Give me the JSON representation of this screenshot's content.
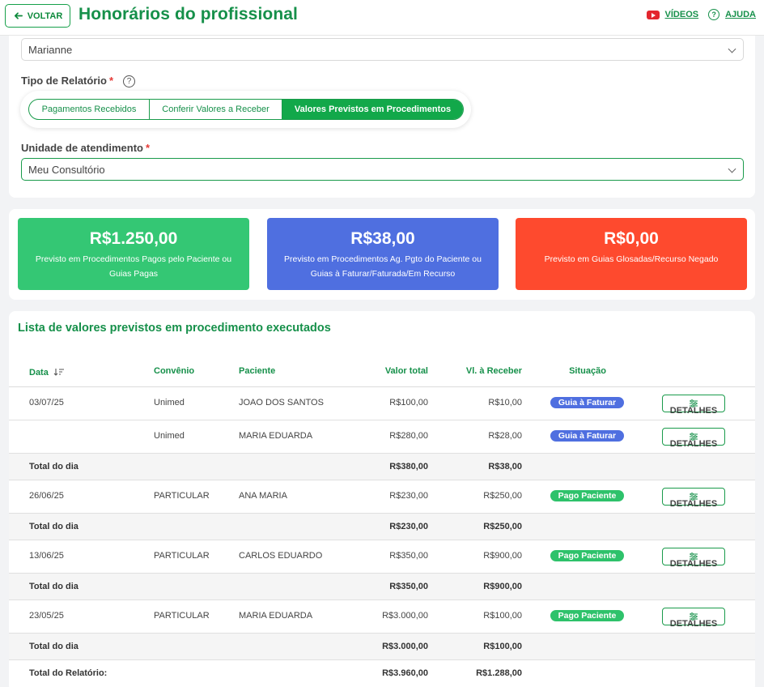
{
  "header": {
    "back_label": "VOLTAR",
    "title": "Honorários do profissional",
    "videos_label": "VÍDEOS",
    "help_label": "AJUDA"
  },
  "filters": {
    "professional_value": "Marianne",
    "report_type_label": "Tipo de Relatório",
    "report_types": [
      "Pagamentos Recebidos",
      "Conferir Valores a Receber",
      "Valores Previstos em Procedimentos"
    ],
    "active_report_type": 2,
    "unit_label": "Unidade de atendimento",
    "unit_value": "Meu Consultório",
    "required_mark": "*"
  },
  "summary": [
    {
      "value": "R$1.250,00",
      "desc": "Previsto em Procedimentos Pagos pelo Paciente ou Guias Pagas",
      "color": "#34c774"
    },
    {
      "value": "R$38,00",
      "desc": "Previsto em Procedimentos Ag. Pgto do Paciente ou Guias à Faturar/Faturada/Em Recurso",
      "color": "#4f6fe0"
    },
    {
      "value": "R$0,00",
      "desc": "Previsto em Guias Glosadas/Recurso Negado",
      "color": "#fe4a2e"
    }
  ],
  "list": {
    "title": "Lista de valores previstos em procedimento executados",
    "columns": {
      "date": "Data",
      "insurance": "Convênio",
      "patient": "Paciente",
      "total": "Valor total",
      "receivable": "Vl. à Receber",
      "status": "Situação"
    },
    "details_label": "DETALHES",
    "rows": [
      {
        "kind": "row",
        "date": "03/07/25",
        "insurance": "Unimed",
        "patient": "JOAO DOS SANTOS",
        "total": "R$100,00",
        "receivable": "R$10,00",
        "status": "Guia à Faturar",
        "status_color": "#4f6fe0"
      },
      {
        "kind": "row",
        "date": "",
        "insurance": "Unimed",
        "patient": "MARIA EDUARDA",
        "total": "R$280,00",
        "receivable": "R$28,00",
        "status": "Guia à Faturar",
        "status_color": "#4f6fe0"
      },
      {
        "kind": "tot",
        "label": "Total do dia",
        "total": "R$380,00",
        "receivable": "R$38,00"
      },
      {
        "kind": "row",
        "date": "26/06/25",
        "insurance": "PARTICULAR",
        "patient": "ANA MARIA",
        "total": "R$230,00",
        "receivable": "R$250,00",
        "status": "Pago Paciente",
        "status_color": "#2ec26b"
      },
      {
        "kind": "tot",
        "label": "Total do dia",
        "total": "R$230,00",
        "receivable": "R$250,00"
      },
      {
        "kind": "row",
        "date": "13/06/25",
        "insurance": "PARTICULAR",
        "patient": "CARLOS EDUARDO",
        "total": "R$350,00",
        "receivable": "R$900,00",
        "status": "Pago Paciente",
        "status_color": "#2ec26b"
      },
      {
        "kind": "tot",
        "label": "Total do dia",
        "total": "R$350,00",
        "receivable": "R$900,00"
      },
      {
        "kind": "row",
        "date": "23/05/25",
        "insurance": "PARTICULAR",
        "patient": "MARIA EDUARDA",
        "total": "R$3.000,00",
        "receivable": "R$100,00",
        "status": "Pago Paciente",
        "status_color": "#2ec26b"
      },
      {
        "kind": "tot",
        "label": "Total do dia",
        "total": "R$3.000,00",
        "receivable": "R$100,00"
      },
      {
        "kind": "final",
        "label": "Total do Relatório:",
        "total": "R$3.960,00",
        "receivable": "R$1.288,00"
      }
    ]
  }
}
